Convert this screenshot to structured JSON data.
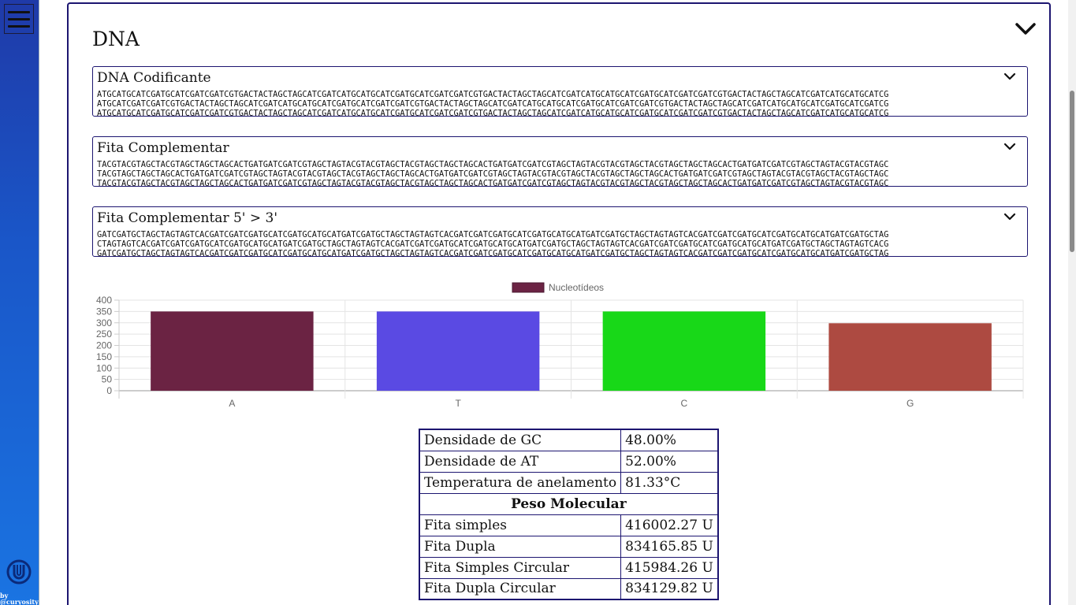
{
  "sidebar": {
    "menu_icon": "hamburger-menu-icon",
    "logo_icon": "u-logo-icon",
    "credit_line1": "by",
    "credit_line2": "@curyosity"
  },
  "main": {
    "title": "DNA",
    "collapse_icon": "chevron-down-icon"
  },
  "sequences": [
    {
      "title": "DNA Codificante",
      "lines": [
        "ATGCATGCATCGATGCATCGATCGATCGTGACTACTAGCTAGCATCGATCATGCATGCATCGATGCATCGATCGATCGTGACTACTAGCTAGCATCGATCATGCATGCATCGATGCATCGATCGATCGTGACTACTAGCTAGCATCGATCATGCATGCATCG",
        "ATGCATCGATCGATCGTGACTACTAGCTAGCATCGATCATGCATGCATCGATGCATCGATCGATCGTGACTACTAGCTAGCATCGATCATGCATGCATCGATGCATCGATCGATCGTGACTACTAGCTAGCATCGATCATGCATGCATCGATGCATCGATCG",
        "ATGCATGCATCGATGCATCGATCGATCGTGACTACTAGCTAGCATCGATCATGCATGCATCGATGCATCGATCGATCGTGACTACTAGCTAGCATCGATCATGCATGCATCGATGCATCGATCGATCGTGACTACTAGCTAGCATCGATCATGCATGCATCG"
      ]
    },
    {
      "title": "Fita Complementar",
      "lines": [
        "TACGTACGTAGCTACGTAGCTAGCTAGCACTGATGATCGATCGTAGCTAGTACGTACGTAGCTACGTAGCTAGCTAGCACTGATGATCGATCGTAGCTAGTACGTACGTAGCTACGTAGCTAGCTAGCACTGATGATCGATCGTAGCTAGTACGTACGTAGC",
        "TACGTAGCTAGCTAGCACTGATGATCGATCGTAGCTAGTACGTACGTAGCTACGTAGCTAGCTAGCACTGATGATCGATCGTAGCTAGTACGTACGTAGCTACGTAGCTAGCTAGCACTGATGATCGATCGTAGCTAGTACGTACGTAGCTACGTAGCTAGC",
        "TACGTACGTAGCTACGTAGCTAGCTAGCACTGATGATCGATCGTAGCTAGTACGTACGTAGCTACGTAGCTAGCTAGCACTGATGATCGATCGTAGCTAGTACGTACGTAGCTACGTAGCTAGCTAGCACTGATGATCGATCGTAGCTAGTACGTACGTAGC"
      ]
    },
    {
      "title": "Fita Complementar 5' > 3'",
      "lines": [
        "GATCGATGCTAGCTAGTAGTCACGATCGATCGATGCATCGATGCATGCATGATCGATGCTAGCTAGTAGTCACGATCGATCGATGCATCGATGCATGCATGATCGATGCTAGCTAGTAGTCACGATCGATCGATGCATCGATGCATGCATGATCGATGCTAG",
        "CTAGTAGTCACGATCGATCGATGCATCGATGCATGCATGATCGATGCTAGCTAGTAGTCACGATCGATCGATGCATCGATGCATGCATGATCGATGCTAGCTAGTAGTCACGATCGATCGATGCATCGATGCATGCATGATCGATGCTAGCTAGTAGTCACG",
        "GATCGATGCTAGCTAGTAGTCACGATCGATCGATGCATCGATGCATGCATGATCGATGCTAGCTAGTAGTCACGATCGATCGATGCATCGATGCATGCATGATCGATGCTAGCTAGTAGTCACGATCGATCGATGCATCGATGCATGCATGATCGATGCTAG"
      ]
    }
  ],
  "chart_data": {
    "type": "bar",
    "categories": [
      "A",
      "T",
      "C",
      "G"
    ],
    "series": [
      {
        "name": "Nucleotídeos",
        "values": [
          350,
          350,
          350,
          298
        ]
      }
    ],
    "colors": [
      "#6b2343",
      "#5a4ae3",
      "#18d818",
      "#ad4a41"
    ],
    "legend_color": "#6b2343",
    "ylim": [
      0,
      400
    ],
    "yticks": [
      400,
      350,
      300,
      250,
      200,
      150,
      100,
      50,
      0
    ],
    "grid": true,
    "legend": "top-center"
  },
  "stats": {
    "rows": [
      {
        "label": "Densidade de GC",
        "value": "48.00%"
      },
      {
        "label": "Densidade de AT",
        "value": "52.00%"
      },
      {
        "label": "Temperatura de anelamento",
        "value": "81.33°C"
      }
    ],
    "section_header": "Peso Molecular",
    "weights": [
      {
        "label": "Fita simples",
        "value": "416002.27 U"
      },
      {
        "label": "Fita Dupla",
        "value": "834165.85 U"
      },
      {
        "label": "Fita Simples Circular",
        "value": "415984.26 U"
      },
      {
        "label": "Fita Dupla Circular",
        "value": "834129.82 U"
      }
    ]
  }
}
